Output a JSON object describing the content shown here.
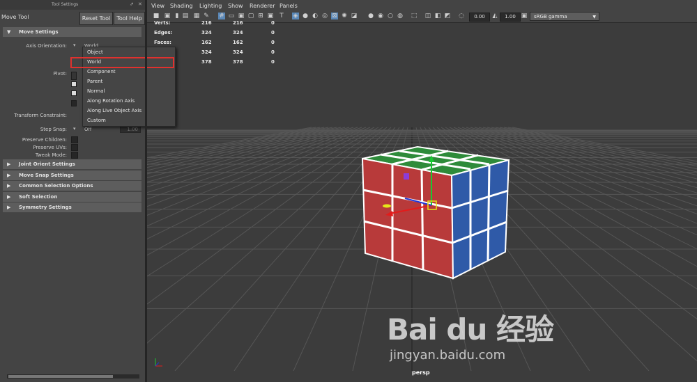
{
  "left_panel": {
    "title_bar": "Tool Settings",
    "tool_name": "Move Tool",
    "reset_button": "Reset Tool",
    "help_button": "Tool Help",
    "sections": [
      {
        "label": "Move Settings",
        "expanded": true
      },
      {
        "label": "Joint Orient Settings",
        "expanded": false
      },
      {
        "label": "Move Snap Settings",
        "expanded": false
      },
      {
        "label": "Common Selection Options",
        "expanded": false
      },
      {
        "label": "Soft Selection",
        "expanded": false
      },
      {
        "label": "Symmetry Settings",
        "expanded": false
      }
    ],
    "axis_orientation": {
      "label": "Axis Orientation:",
      "value": "World"
    },
    "pivot_label": "Pivot:",
    "transform_constraint_label": "Transform Constraint:",
    "step_snap": {
      "label": "Step Snap:",
      "value": "Off",
      "amount": "1.00"
    },
    "preserve_children_label": "Preserve Children:",
    "preserve_uvs_label": "Preserve UVs:",
    "tweak_mode_label": "Tweak Mode:"
  },
  "dropdown": {
    "items": [
      "Object",
      "World",
      "Component",
      "Parent",
      "Normal",
      "Along Rotation Axis",
      "Along Live Object Axis",
      "Custom"
    ],
    "selected": "World",
    "highlight_color": "#e0312e"
  },
  "viewport": {
    "menus": [
      "View",
      "Shading",
      "Lighting",
      "Show",
      "Renderer",
      "Panels"
    ],
    "exposure": "0.00",
    "gamma": "1.00",
    "color_space": "sRGB gamma",
    "hud": [
      {
        "label": "Verts:",
        "a": "216",
        "b": "216",
        "c": "0"
      },
      {
        "label": "Edges:",
        "a": "324",
        "b": "324",
        "c": "0"
      },
      {
        "label": "Faces:",
        "a": "162",
        "b": "162",
        "c": "0"
      },
      {
        "label": "",
        "a": "324",
        "b": "324",
        "c": "0"
      },
      {
        "label": "",
        "a": "378",
        "b": "378",
        "c": "0"
      }
    ],
    "camera_label": "persp",
    "cube_colors": {
      "top": "#2e8b3a",
      "front": "#b83a3a",
      "right": "#2f5aa8"
    }
  },
  "watermark": {
    "brand": "Bai du 经验",
    "url": "jingyan.baidu.com"
  }
}
